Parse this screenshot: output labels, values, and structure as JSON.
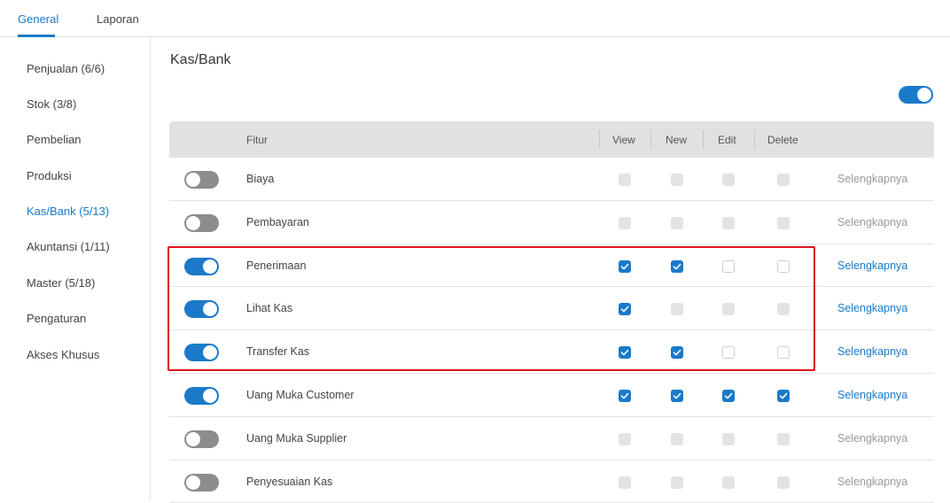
{
  "tabs": [
    {
      "label": "General",
      "active": true
    },
    {
      "label": "Laporan",
      "active": false
    }
  ],
  "sidebar": {
    "items": [
      {
        "label": "Penjualan (6/6)",
        "active": false
      },
      {
        "label": "Stok (3/8)",
        "active": false
      },
      {
        "label": "Pembelian",
        "active": false
      },
      {
        "label": "Produksi",
        "active": false
      },
      {
        "label": "Kas/Bank (5/13)",
        "active": true
      },
      {
        "label": "Akuntansi (1/11)",
        "active": false
      },
      {
        "label": "Master (5/18)",
        "active": false
      },
      {
        "label": "Pengaturan",
        "active": false
      },
      {
        "label": "Akses Khusus",
        "active": false
      }
    ]
  },
  "section": {
    "title": "Kas/Bank",
    "master_toggle_on": true
  },
  "table": {
    "headers": {
      "feature": "Fitur",
      "view": "View",
      "new": "New",
      "edit": "Edit",
      "delete": "Delete"
    },
    "rows": [
      {
        "name": "Biaya",
        "enabled": false,
        "view": "disabled",
        "new": "disabled",
        "edit": "disabled",
        "delete": "disabled",
        "more": "Selengkapnya"
      },
      {
        "name": "Pembayaran",
        "enabled": false,
        "view": "disabled",
        "new": "disabled",
        "edit": "disabled",
        "delete": "disabled",
        "more": "Selengkapnya"
      },
      {
        "name": "Penerimaan",
        "enabled": true,
        "view": "checked",
        "new": "checked",
        "edit": "unchecked",
        "delete": "unchecked",
        "more": "Selengkapnya"
      },
      {
        "name": "Lihat Kas",
        "enabled": true,
        "view": "checked",
        "new": "disabled",
        "edit": "disabled",
        "delete": "disabled",
        "more": "Selengkapnya"
      },
      {
        "name": "Transfer Kas",
        "enabled": true,
        "view": "checked",
        "new": "checked",
        "edit": "unchecked",
        "delete": "unchecked",
        "more": "Selengkapnya"
      },
      {
        "name": "Uang Muka Customer",
        "enabled": true,
        "view": "checked",
        "new": "checked",
        "edit": "checked",
        "delete": "checked",
        "more": "Selengkapnya"
      },
      {
        "name": "Uang Muka Supplier",
        "enabled": false,
        "view": "disabled",
        "new": "disabled",
        "edit": "disabled",
        "delete": "disabled",
        "more": "Selengkapnya"
      },
      {
        "name": "Penyesuaian Kas",
        "enabled": false,
        "view": "disabled",
        "new": "disabled",
        "edit": "disabled",
        "delete": "disabled",
        "more": "Selengkapnya"
      }
    ]
  },
  "colors": {
    "accent": "#1a7ac9",
    "highlight_border": "#e0141e",
    "toggle_off": "#8d8d8d"
  },
  "icons": {
    "check": "check-icon"
  }
}
